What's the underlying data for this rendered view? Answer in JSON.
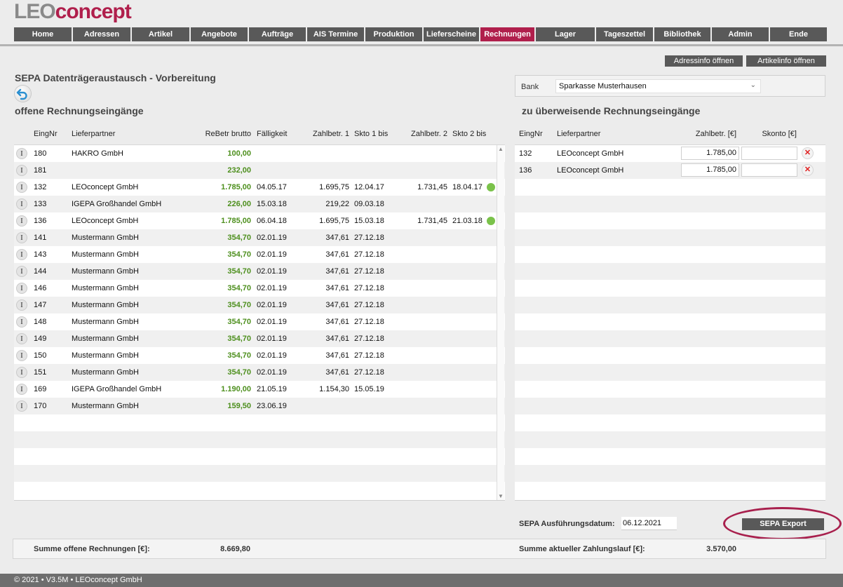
{
  "logo": {
    "part1": "LEO",
    "part2": "concept"
  },
  "nav": [
    {
      "label": "Home",
      "active": false
    },
    {
      "label": "Adressen",
      "active": false
    },
    {
      "label": "Artikel",
      "active": false
    },
    {
      "label": "Angebote",
      "active": false
    },
    {
      "label": "Aufträge",
      "active": false
    },
    {
      "label": "AIS Termine",
      "active": false
    },
    {
      "label": "Produktion",
      "active": false
    },
    {
      "label": "Lieferscheine",
      "active": false
    },
    {
      "label": "Rechnungen",
      "active": true
    },
    {
      "label": "Lager",
      "active": false
    },
    {
      "label": "Tageszettel",
      "active": false
    },
    {
      "label": "Bibliothek",
      "active": false
    },
    {
      "label": "Admin",
      "active": false
    },
    {
      "label": "Ende",
      "active": false
    }
  ],
  "actions": {
    "adressinfo": "Adressinfo öffnen",
    "artikelinfo": "Artikelinfo öffnen"
  },
  "page": {
    "title": "SEPA Datenträgeraustausch - Vorbereitung",
    "left_heading": "offene Rechnungseingänge",
    "right_heading": "zu überweisende Rechnungseingänge"
  },
  "bank": {
    "label": "Bank",
    "selected": "Sparkasse Musterhausen"
  },
  "left_table": {
    "headers": {
      "nr": "EingNr",
      "partner": "Lieferpartner",
      "brutto": "ReBetr brutto",
      "faellig": "Fälligkeit",
      "z1": "Zahlbetr. 1",
      "s1": "Skto 1 bis",
      "z2": "Zahlbetr. 2",
      "s2": "Skto 2 bis"
    },
    "rows": [
      {
        "nr": "180",
        "partner": "HAKRO GmbH",
        "brutto": "100,00",
        "faellig": "",
        "z1": "",
        "s1": "",
        "z2": "",
        "s2": "",
        "dot": false
      },
      {
        "nr": "181",
        "partner": "",
        "brutto": "232,00",
        "faellig": "",
        "z1": "",
        "s1": "",
        "z2": "",
        "s2": "",
        "dot": false
      },
      {
        "nr": "132",
        "partner": "LEOconcept GmbH",
        "brutto": "1.785,00",
        "faellig": "04.05.17",
        "z1": "1.695,75",
        "s1": "12.04.17",
        "z2": "1.731,45",
        "s2": "18.04.17",
        "dot": true
      },
      {
        "nr": "133",
        "partner": "IGEPA Großhandel GmbH",
        "brutto": "226,00",
        "faellig": "15.03.18",
        "z1": "219,22",
        "s1": "09.03.18",
        "z2": "",
        "s2": "",
        "dot": false
      },
      {
        "nr": "136",
        "partner": "LEOconcept GmbH",
        "brutto": "1.785,00",
        "faellig": "06.04.18",
        "z1": "1.695,75",
        "s1": "15.03.18",
        "z2": "1.731,45",
        "s2": "21.03.18",
        "dot": true
      },
      {
        "nr": "141",
        "partner": "Mustermann GmbH",
        "brutto": "354,70",
        "faellig": "02.01.19",
        "z1": "347,61",
        "s1": "27.12.18",
        "z2": "",
        "s2": "",
        "dot": false
      },
      {
        "nr": "143",
        "partner": "Mustermann GmbH",
        "brutto": "354,70",
        "faellig": "02.01.19",
        "z1": "347,61",
        "s1": "27.12.18",
        "z2": "",
        "s2": "",
        "dot": false
      },
      {
        "nr": "144",
        "partner": "Mustermann GmbH",
        "brutto": "354,70",
        "faellig": "02.01.19",
        "z1": "347,61",
        "s1": "27.12.18",
        "z2": "",
        "s2": "",
        "dot": false
      },
      {
        "nr": "146",
        "partner": "Mustermann GmbH",
        "brutto": "354,70",
        "faellig": "02.01.19",
        "z1": "347,61",
        "s1": "27.12.18",
        "z2": "",
        "s2": "",
        "dot": false
      },
      {
        "nr": "147",
        "partner": "Mustermann GmbH",
        "brutto": "354,70",
        "faellig": "02.01.19",
        "z1": "347,61",
        "s1": "27.12.18",
        "z2": "",
        "s2": "",
        "dot": false
      },
      {
        "nr": "148",
        "partner": "Mustermann GmbH",
        "brutto": "354,70",
        "faellig": "02.01.19",
        "z1": "347,61",
        "s1": "27.12.18",
        "z2": "",
        "s2": "",
        "dot": false
      },
      {
        "nr": "149",
        "partner": "Mustermann GmbH",
        "brutto": "354,70",
        "faellig": "02.01.19",
        "z1": "347,61",
        "s1": "27.12.18",
        "z2": "",
        "s2": "",
        "dot": false
      },
      {
        "nr": "150",
        "partner": "Mustermann GmbH",
        "brutto": "354,70",
        "faellig": "02.01.19",
        "z1": "347,61",
        "s1": "27.12.18",
        "z2": "",
        "s2": "",
        "dot": false
      },
      {
        "nr": "151",
        "partner": "Mustermann GmbH",
        "brutto": "354,70",
        "faellig": "02.01.19",
        "z1": "347,61",
        "s1": "27.12.18",
        "z2": "",
        "s2": "",
        "dot": false
      },
      {
        "nr": "169",
        "partner": "IGEPA Großhandel GmbH",
        "brutto": "1.190,00",
        "faellig": "21.05.19",
        "z1": "1.154,30",
        "s1": "15.05.19",
        "z2": "",
        "s2": "",
        "dot": false
      },
      {
        "nr": "170",
        "partner": "Mustermann GmbH",
        "brutto": "159,50",
        "faellig": "23.06.19",
        "z1": "",
        "s1": "",
        "z2": "",
        "s2": "",
        "dot": false
      }
    ]
  },
  "right_table": {
    "headers": {
      "nr": "EingNr",
      "partner": "Lieferpartner",
      "zahlbetr": "Zahlbetr. [€]",
      "skonto": "Skonto [€]"
    },
    "rows": [
      {
        "nr": "132",
        "partner": "LEOconcept GmbH",
        "zahlbetr": "1.785,00",
        "skonto": ""
      },
      {
        "nr": "136",
        "partner": "LEOconcept GmbH",
        "zahlbetr": "1.785,00",
        "skonto": ""
      }
    ]
  },
  "sepa": {
    "date_label": "SEPA Ausführungsdatum:",
    "date_value": "06.12.2021",
    "export_label": "SEPA Export"
  },
  "summary": {
    "open_label": "Summe offene Rechnungen [€]:",
    "open_value": "8.669,80",
    "run_label": "Summe aktueller Zahlungslauf [€]:",
    "run_value": "3.570,00"
  },
  "footer": "© 2021 • V3.5M • LEOconcept GmbH",
  "colors": {
    "accent": "#b01f4c",
    "nav": "#595959",
    "amount_green": "#4d8f1d",
    "dot_green": "#7ac24a"
  },
  "icons": {
    "back": "back-arrow-icon",
    "info": "info-icon",
    "delete": "delete-x-icon"
  }
}
